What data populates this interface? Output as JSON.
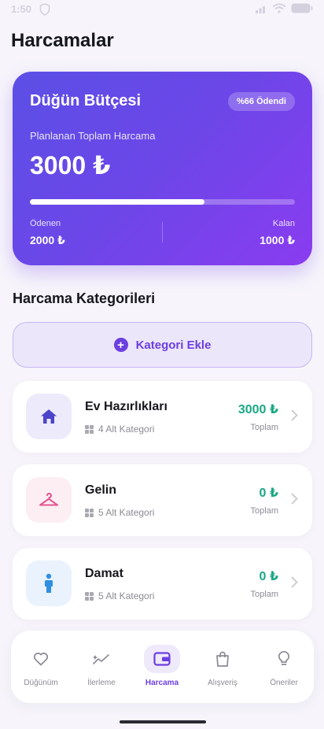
{
  "status_bar": {
    "time": "1:50"
  },
  "header": {
    "title": "Harcamalar"
  },
  "budget": {
    "title": "Düğün Bütçesi",
    "paid_badge": "%66 Ödendi",
    "planned_label": "Planlanan Toplam Harcama",
    "planned_total": "3000 ₺",
    "progress_fraction": 0.66,
    "paid_label": "Ödenen",
    "paid_value": "2000 ₺",
    "remaining_label": "Kalan",
    "remaining_value": "1000 ₺"
  },
  "categories_section": {
    "title": "Harcama Kategorileri",
    "add_label": "Kategori Ekle",
    "items": [
      {
        "name": "Ev Hazırlıkları",
        "sub": "4 Alt Kategori",
        "amount": "3000 ₺",
        "total_label": "Toplam",
        "icon": "house-icon",
        "color": "#4b45c9"
      },
      {
        "name": "Gelin",
        "sub": "5 Alt Kategori",
        "amount": "0 ₺",
        "total_label": "Toplam",
        "icon": "hanger-icon",
        "color": "#e2558f"
      },
      {
        "name": "Damat",
        "sub": "5 Alt Kategori",
        "amount": "0 ₺",
        "total_label": "Toplam",
        "icon": "person-icon",
        "color": "#2f8fe0"
      }
    ]
  },
  "bottom_nav": {
    "items": [
      {
        "label": "Düğünüm",
        "icon": "heart-icon"
      },
      {
        "label": "İlerleme",
        "icon": "trend-icon"
      },
      {
        "label": "Harcama",
        "icon": "wallet-icon",
        "active": true
      },
      {
        "label": "Alışveriş",
        "icon": "bag-icon"
      },
      {
        "label": "Öneriler",
        "icon": "bulb-icon"
      }
    ]
  },
  "colors": {
    "accent": "#6b3fe0",
    "amount_green": "#1aa784"
  }
}
